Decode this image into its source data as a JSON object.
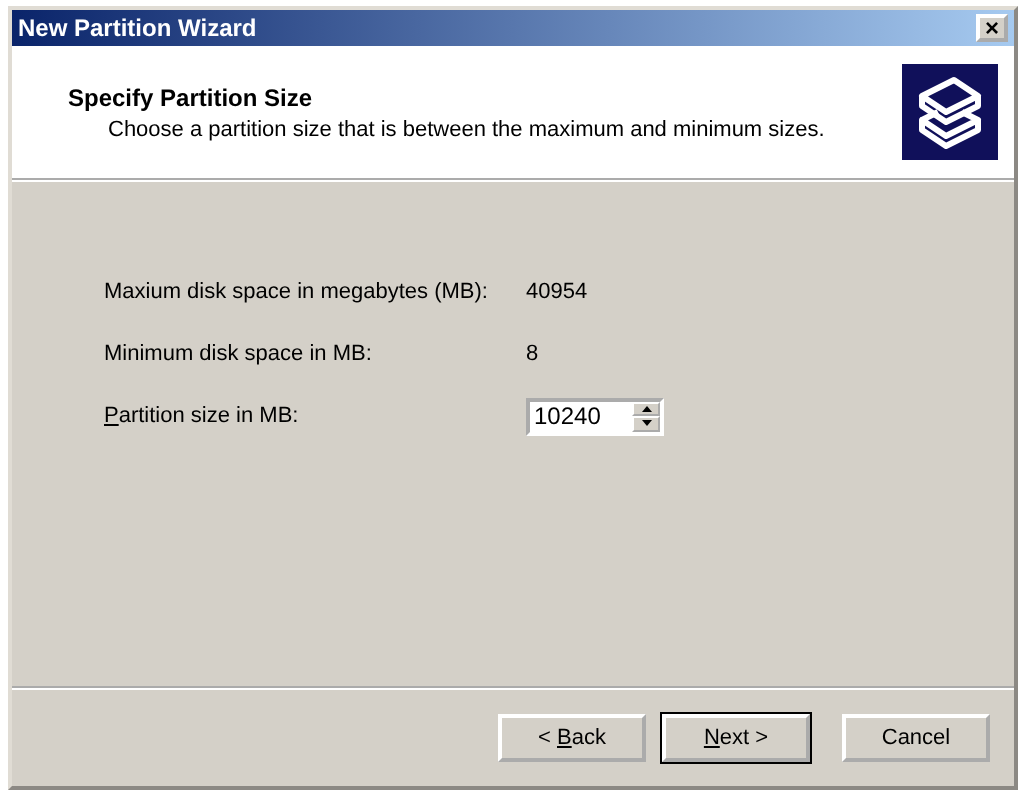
{
  "window": {
    "title": "New Partition Wizard",
    "close": "×"
  },
  "header": {
    "title": "Specify Partition Size",
    "subtitle": "Choose a partition size that is between the maximum and minimum sizes."
  },
  "rows": [
    {
      "kind": "info",
      "label": {
        "pre": "Maxium disk space in megabytes (MB):"
      },
      "value": "40954"
    },
    {
      "kind": "info",
      "label": {
        "pre": "Minimum disk space in MB:"
      },
      "value": "8"
    },
    {
      "kind": "spin",
      "label": {
        "key": "P",
        "post": "artition size in MB:"
      },
      "value": "10240"
    }
  ],
  "buttons": [
    {
      "label": {
        "pre": "< ",
        "key": "B",
        "post": "ack"
      },
      "default": false
    },
    {
      "label": {
        "key": "N",
        "post": "ext >"
      },
      "default": true
    },
    {
      "label": {
        "pre": "Cancel"
      },
      "default": false
    }
  ]
}
